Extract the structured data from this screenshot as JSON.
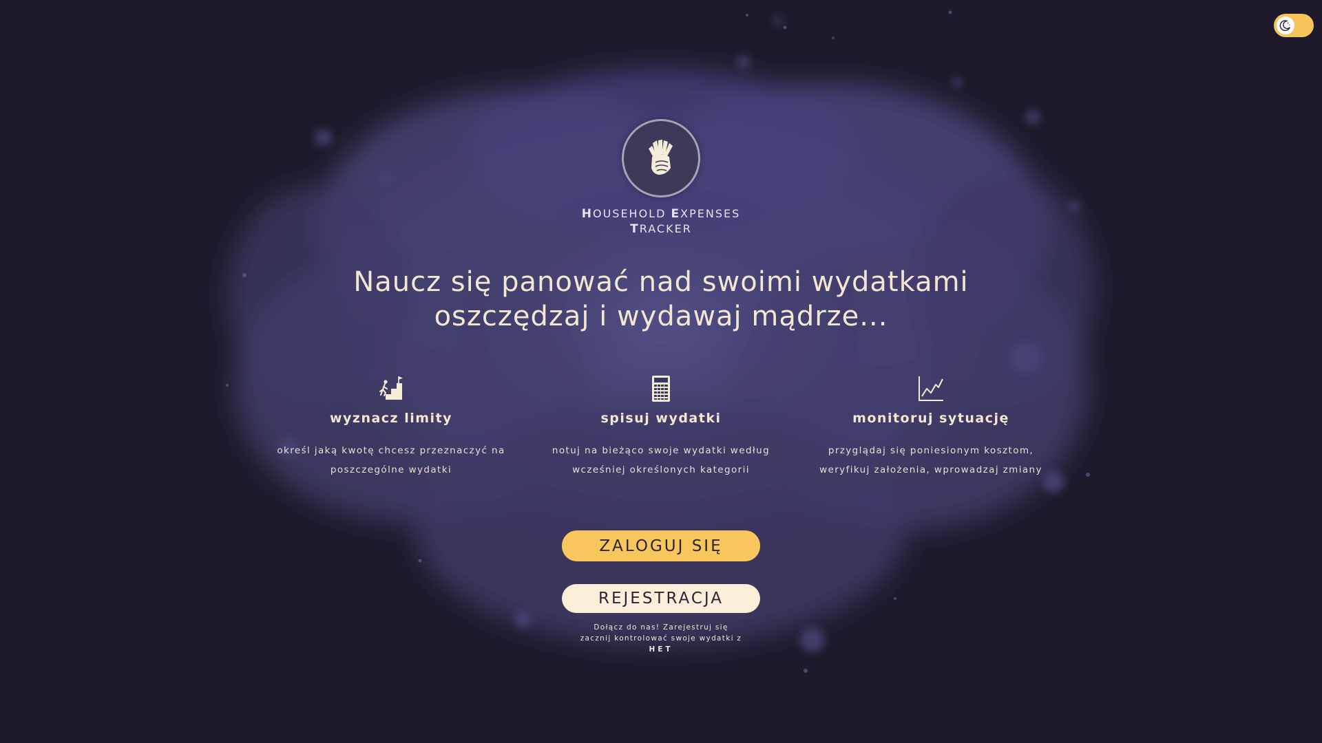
{
  "theme_toggle": {
    "icon": "moon-icon",
    "mode": "dark",
    "color": "#f6c45a"
  },
  "logo": {
    "icon": "money-hand-icon"
  },
  "brand": {
    "line1_cap1": "H",
    "line1_rest1": "OUSEHOLD ",
    "line1_cap2": "E",
    "line1_rest2": "XPENSES",
    "line2_cap": "T",
    "line2_rest": "RACKER"
  },
  "headline": {
    "line1": "Naucz się panować nad swoimi wydatkami",
    "line2": "oszczędzaj i wydawaj mądrze..."
  },
  "features": [
    {
      "icon": "stairs-goal-icon",
      "title": "wyznacz limity",
      "desc_line1": "określ jaką kwotę chcesz przeznaczyć na",
      "desc_line2": "poszczególne wydatki"
    },
    {
      "icon": "calculator-icon",
      "title": "spisuj wydatki",
      "desc_line1": "notuj na bieżąco swoje wydatki według",
      "desc_line2": "wcześniej określonych kategorii"
    },
    {
      "icon": "line-chart-icon",
      "title": "monitoruj sytuację",
      "desc_line1": "przyglądaj się poniesionym kosztom,",
      "desc_line2": "weryfikuj założenia, wprowadzaj zmiany"
    }
  ],
  "buttons": {
    "login_label": "ZALOGUJ SIĘ",
    "register_label": "REJESTRACJA"
  },
  "join_note": {
    "line1": "Dołącz do nas! Zarejestruj się",
    "line2_prefix": "zacznij kontrolować swoje wydatki z ",
    "line2_brand": "HET"
  },
  "colors": {
    "background": "#1e1a2c",
    "cloud": "#4b4677",
    "accent": "#f8c65d",
    "button_light": "#fbefd9",
    "text": "#f3e6d2"
  }
}
